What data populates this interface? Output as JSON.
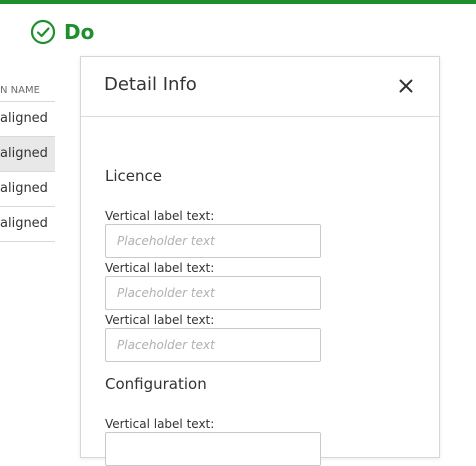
{
  "brand": {
    "name": "Do",
    "color": "#1f8f2e",
    "icon": "check-circle-icon"
  },
  "list": {
    "column_header": "N NAME",
    "rows": [
      {
        "label": "aligned",
        "selected": false
      },
      {
        "label": "aligned",
        "selected": true
      },
      {
        "label": "aligned",
        "selected": false
      },
      {
        "label": "aligned",
        "selected": false
      }
    ]
  },
  "panel": {
    "title": "Detail Info",
    "close_icon": "close-icon",
    "sections": [
      {
        "title": "Licence",
        "fields": [
          {
            "label": "Vertical label text:",
            "placeholder": "Placeholder text"
          },
          {
            "label": "Vertical label text:",
            "placeholder": "Placeholder text"
          },
          {
            "label": "Vertical label text:",
            "placeholder": "Placeholder text"
          }
        ]
      },
      {
        "title": "Configuration",
        "fields": [
          {
            "label": "Vertical label text:",
            "placeholder": ""
          }
        ]
      }
    ]
  }
}
